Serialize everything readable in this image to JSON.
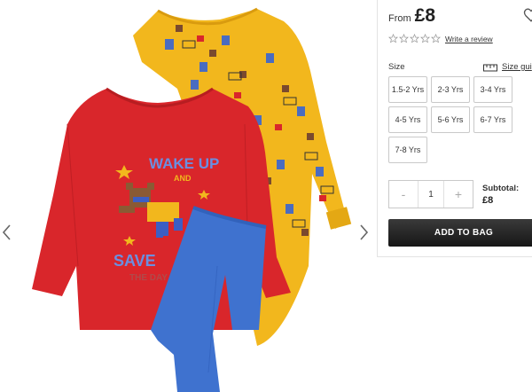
{
  "product": {
    "from_label": "From",
    "price": "£8",
    "review_link": "Write a review",
    "rating_stars": 0,
    "rating_max": 5
  },
  "shirt_print": {
    "line1": "WAKE UP",
    "line2": "AND",
    "line3": "SAVE",
    "line4": "THE DAY"
  },
  "size": {
    "label": "Size",
    "guide_label": "Size gui",
    "options": [
      "1.5-2 Yrs",
      "2-3 Yrs",
      "3-4 Yrs",
      "4-5 Yrs",
      "5-6 Yrs",
      "6-7 Yrs",
      "7-8 Yrs"
    ]
  },
  "quantity": {
    "minus": "-",
    "value": "1",
    "plus": "+"
  },
  "subtotal": {
    "label": "Subtotal:",
    "value": "£8"
  },
  "cta": {
    "add_to_bag": "ADD TO BAG"
  },
  "colors": {
    "red_top": "#d9262b",
    "yellow_top": "#f2b71d",
    "blue_bottoms": "#3f72cf"
  }
}
